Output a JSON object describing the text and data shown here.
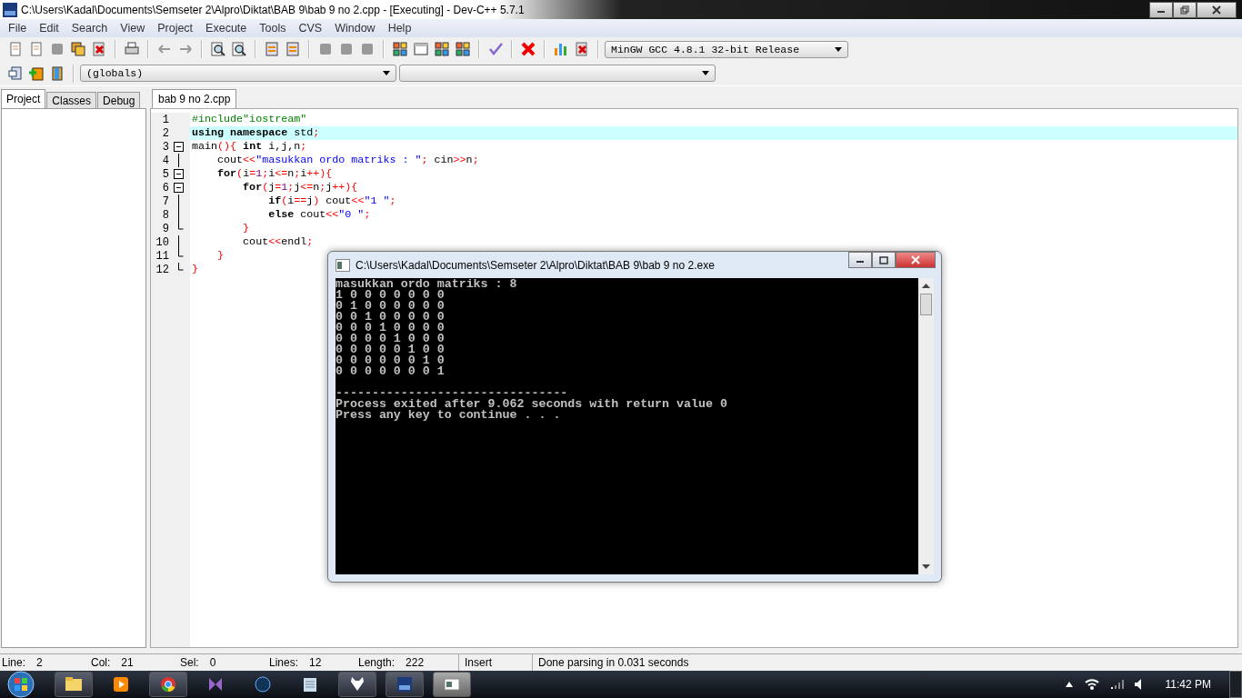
{
  "window": {
    "title": "C:\\Users\\Kadal\\Documents\\Semseter 2\\Alpro\\Diktat\\BAB 9\\bab 9 no 2.cpp - [Executing] - Dev-C++ 5.7.1"
  },
  "menu": [
    "File",
    "Edit",
    "Search",
    "View",
    "Project",
    "Execute",
    "Tools",
    "CVS",
    "Window",
    "Help"
  ],
  "compiler": {
    "value": "MinGW GCC 4.8.1 32-bit Release"
  },
  "scope": {
    "value": "(globals)"
  },
  "panel_tabs": [
    {
      "label": "Project",
      "selected": true
    },
    {
      "label": "Classes",
      "selected": false
    },
    {
      "label": "Debug",
      "selected": false
    }
  ],
  "editor_tabs": [
    {
      "label": "bab 9 no 2.cpp",
      "selected": true
    }
  ],
  "code": [
    {
      "number": "1",
      "kind": "plain",
      "selected": false,
      "tokens": [
        {
          "kind": "pre",
          "text": "#include\"iostream\""
        }
      ]
    },
    {
      "number": "2",
      "kind": "plain",
      "selected": true,
      "tokens": [
        {
          "kind": "kw",
          "text": "using namespace"
        },
        {
          "kind": "plain",
          "text": " std"
        },
        {
          "kind": "sym",
          "text": ";"
        }
      ]
    },
    {
      "number": "3",
      "kind": "fold_start",
      "selected": false,
      "tokens": [
        {
          "kind": "plain",
          "text": "main"
        },
        {
          "kind": "sym",
          "text": "(){"
        },
        {
          "kind": "kw",
          "text": " int"
        },
        {
          "kind": "plain",
          "text": " i,j,n"
        },
        {
          "kind": "sym",
          "text": ";"
        }
      ]
    },
    {
      "number": "4",
      "kind": "fold_line",
      "selected": false,
      "tokens": [
        {
          "kind": "plain",
          "text": "    cout"
        },
        {
          "kind": "sym",
          "text": "<<"
        },
        {
          "kind": "str",
          "text": "\"masukkan ordo matriks : \""
        },
        {
          "kind": "sym",
          "text": ";"
        },
        {
          "kind": "plain",
          "text": " cin"
        },
        {
          "kind": "sym",
          "text": ">>"
        },
        {
          "kind": "plain",
          "text": "n"
        },
        {
          "kind": "sym",
          "text": ";"
        }
      ]
    },
    {
      "number": "5",
      "kind": "fold_start",
      "selected": false,
      "tokens": [
        {
          "kind": "kw",
          "text": "    for"
        },
        {
          "kind": "sym",
          "text": "("
        },
        {
          "kind": "plain",
          "text": "i"
        },
        {
          "kind": "sym",
          "text": "="
        },
        {
          "kind": "num",
          "text": "1"
        },
        {
          "kind": "sym",
          "text": ";"
        },
        {
          "kind": "plain",
          "text": "i"
        },
        {
          "kind": "sym",
          "text": "<="
        },
        {
          "kind": "plain",
          "text": "n"
        },
        {
          "kind": "sym",
          "text": ";"
        },
        {
          "kind": "plain",
          "text": "i"
        },
        {
          "kind": "sym",
          "text": "++){"
        }
      ]
    },
    {
      "number": "6",
      "kind": "fold_start",
      "selected": false,
      "tokens": [
        {
          "kind": "kw",
          "text": "        for"
        },
        {
          "kind": "sym",
          "text": "("
        },
        {
          "kind": "plain",
          "text": "j"
        },
        {
          "kind": "sym",
          "text": "="
        },
        {
          "kind": "num",
          "text": "1"
        },
        {
          "kind": "sym",
          "text": ";"
        },
        {
          "kind": "plain",
          "text": "j"
        },
        {
          "kind": "sym",
          "text": "<="
        },
        {
          "kind": "plain",
          "text": "n"
        },
        {
          "kind": "sym",
          "text": ";"
        },
        {
          "kind": "plain",
          "text": "j"
        },
        {
          "kind": "sym",
          "text": "++){"
        }
      ]
    },
    {
      "number": "7",
      "kind": "fold_line",
      "selected": false,
      "tokens": [
        {
          "kind": "kw",
          "text": "            if"
        },
        {
          "kind": "sym",
          "text": "("
        },
        {
          "kind": "plain",
          "text": "i"
        },
        {
          "kind": "sym",
          "text": "=="
        },
        {
          "kind": "plain",
          "text": "j"
        },
        {
          "kind": "sym",
          "text": ")"
        },
        {
          "kind": "plain",
          "text": " cout"
        },
        {
          "kind": "sym",
          "text": "<<"
        },
        {
          "kind": "str",
          "text": "\"1 \""
        },
        {
          "kind": "sym",
          "text": ";"
        }
      ]
    },
    {
      "number": "8",
      "kind": "fold_line",
      "selected": false,
      "tokens": [
        {
          "kind": "kw",
          "text": "            else"
        },
        {
          "kind": "plain",
          "text": " cout"
        },
        {
          "kind": "sym",
          "text": "<<"
        },
        {
          "kind": "str",
          "text": "\"0 \""
        },
        {
          "kind": "sym",
          "text": ";"
        }
      ]
    },
    {
      "number": "9",
      "kind": "fold_end",
      "selected": false,
      "tokens": [
        {
          "kind": "sym",
          "text": "        }"
        }
      ]
    },
    {
      "number": "10",
      "kind": "fold_line",
      "selected": false,
      "tokens": [
        {
          "kind": "plain",
          "text": "        cout"
        },
        {
          "kind": "sym",
          "text": "<<"
        },
        {
          "kind": "plain",
          "text": "endl"
        },
        {
          "kind": "sym",
          "text": ";"
        }
      ]
    },
    {
      "number": "11",
      "kind": "fold_end",
      "selected": false,
      "tokens": [
        {
          "kind": "sym",
          "text": "    }"
        }
      ]
    },
    {
      "number": "12",
      "kind": "fold_end",
      "selected": false,
      "tokens": [
        {
          "kind": "sym",
          "text": "}"
        }
      ]
    }
  ],
  "console": {
    "title": "C:\\Users\\Kadal\\Documents\\Semseter 2\\Alpro\\Diktat\\BAB 9\\bab 9 no 2.exe",
    "sections": [
      [
        "masukkan ordo matriks : 8",
        "1 0 0 0 0 0 0 0",
        "0 1 0 0 0 0 0 0",
        "0 0 1 0 0 0 0 0",
        "0 0 0 1 0 0 0 0",
        "0 0 0 0 1 0 0 0",
        "0 0 0 0 0 1 0 0",
        "0 0 0 0 0 0 1 0",
        "0 0 0 0 0 0 0 1"
      ],
      [
        "--------------------------------",
        "Process exited after 9.062 seconds with return value 0",
        "Press any key to continue . . ."
      ]
    ]
  },
  "status_bar": [
    {
      "label": "Line:",
      "value": "2"
    },
    {
      "label": "Col:",
      "value": "21"
    },
    {
      "label": "Sel:",
      "value": "0"
    },
    {
      "label": "Lines:",
      "value": "12"
    },
    {
      "label": "Length:",
      "value": "222"
    }
  ],
  "status_mode": "Insert",
  "status_message": "Done parsing in 0.031 seconds",
  "clock": "11:42 PM"
}
